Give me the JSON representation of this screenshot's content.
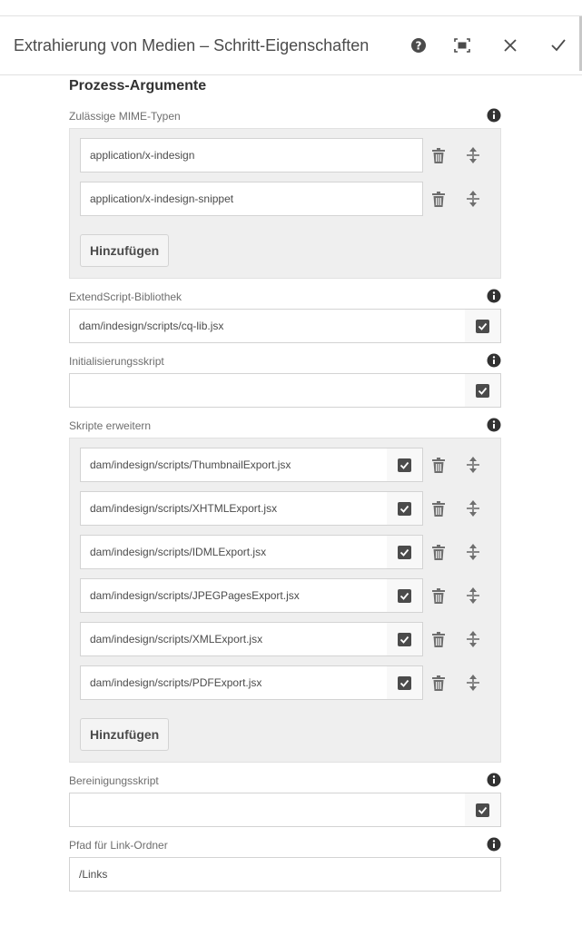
{
  "header": {
    "title": "Extrahierung von Medien – Schritt-Eigenschaften"
  },
  "section": {
    "title": "Prozess-Argumente"
  },
  "mime": {
    "label": "Zulässige MIME-Typen",
    "items": [
      "application/x-indesign",
      "application/x-indesign-snippet"
    ],
    "add_label": "Hinzufügen"
  },
  "extendscript": {
    "label": "ExtendScript-Bibliothek",
    "value": "dam/indesign/scripts/cq-lib.jsx"
  },
  "init": {
    "label": "Initialisierungsskript",
    "value": ""
  },
  "scripts": {
    "label": "Skripte erweitern",
    "items": [
      "dam/indesign/scripts/ThumbnailExport.jsx",
      "dam/indesign/scripts/XHTMLExport.jsx",
      "dam/indesign/scripts/IDMLExport.jsx",
      "dam/indesign/scripts/JPEGPagesExport.jsx",
      "dam/indesign/scripts/XMLExport.jsx",
      "dam/indesign/scripts/PDFExport.jsx"
    ],
    "add_label": "Hinzufügen"
  },
  "cleanup": {
    "label": "Bereinigungsskript",
    "value": ""
  },
  "links": {
    "label": "Pfad für Link-Ordner",
    "value": "/Links"
  }
}
